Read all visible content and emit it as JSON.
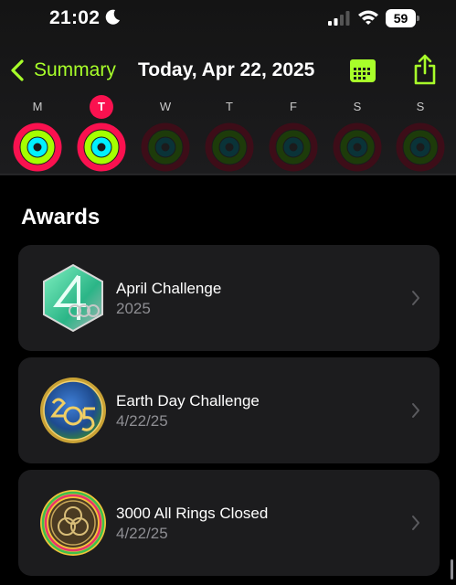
{
  "status_bar": {
    "time": "21:02",
    "battery": "59"
  },
  "nav": {
    "back_label": "Summary",
    "title": "Today, Apr 22, 2025"
  },
  "week": [
    {
      "letter": "M",
      "state": "complete"
    },
    {
      "letter": "T",
      "state": "today"
    },
    {
      "letter": "W",
      "state": "future"
    },
    {
      "letter": "T",
      "state": "future"
    },
    {
      "letter": "F",
      "state": "future"
    },
    {
      "letter": "S",
      "state": "future"
    },
    {
      "letter": "S",
      "state": "future"
    }
  ],
  "awards": {
    "heading": "Awards",
    "items": [
      {
        "title": "April Challenge",
        "subtitle": "2025",
        "badge": "april-challenge-badge"
      },
      {
        "title": "Earth Day Challenge",
        "subtitle": "4/22/25",
        "badge": "earth-day-badge"
      },
      {
        "title": "3000 All Rings Closed",
        "subtitle": "4/22/25",
        "badge": "all-rings-closed-badge"
      }
    ]
  },
  "colors": {
    "accent": "#a8ff2a",
    "move": "#fa114f",
    "exercise": "#a4ff00",
    "stand": "#00f0ff",
    "card": "#1c1c1e"
  }
}
